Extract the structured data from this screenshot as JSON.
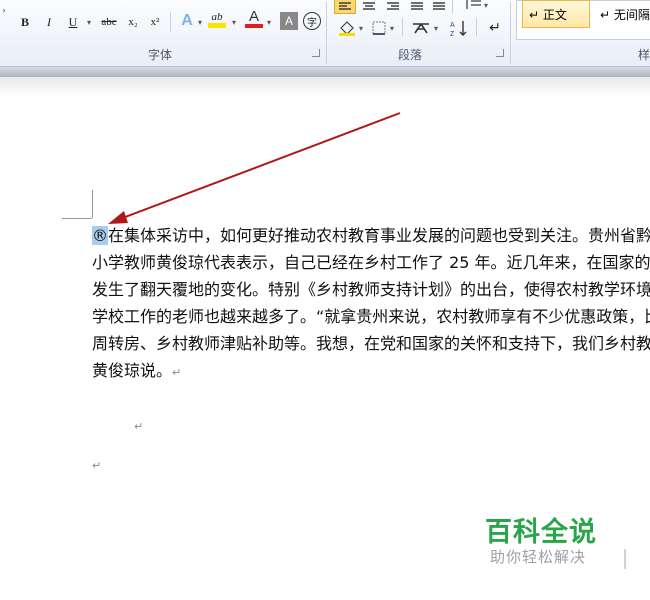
{
  "ribbon": {
    "font_group": {
      "label": "字体",
      "bold": "B",
      "italic": "I",
      "underline": "U",
      "strikethrough": "abc",
      "subscript": "x₂",
      "superscript": "x²",
      "highlight_text": "ab",
      "font_color_text": "A",
      "char_shading_text": "A",
      "enclose_char_text": "字"
    },
    "paragraph_group": {
      "label": "段落"
    },
    "styles_group": {
      "label": "样",
      "styles": [
        "↵ 正文",
        "↵ 无间隔"
      ]
    },
    "colors": {
      "highlight": "#f5e500",
      "font_color": "#e02020",
      "accent": "#2a6ebb"
    }
  },
  "document": {
    "lines": [
      {
        "selected": "®",
        "text": "在集体采访中，如何更好推动农村教育事业发展的问题也受到关注。贵州省黔东"
      },
      {
        "text": "小学教师黄俊琼代表表示，自己已经在乡村工作了 25 年。近几年来，在国家的关"
      },
      {
        "text": "发生了翻天覆地的变化。特别《乡村教师支持计划》的出台，使得农村教学环境得"
      },
      {
        "text": "学校工作的老师也越来越多了。“就拿贵州来说，农村教师享有不少优惠政策，比"
      },
      {
        "text": "周转房、乡村教师津贴补助等。我想，在党和国家的关怀和支持下，我们乡村教师"
      },
      {
        "text": "黄俊琼说。",
        "mark": "↵"
      }
    ],
    "empty_marks": [
      "↵",
      "↵"
    ],
    "arrow_color": "#b01818"
  },
  "watermark": {
    "title": "百科全说",
    "subtitle": "助你轻松解决",
    "color": "#2aa64a"
  }
}
